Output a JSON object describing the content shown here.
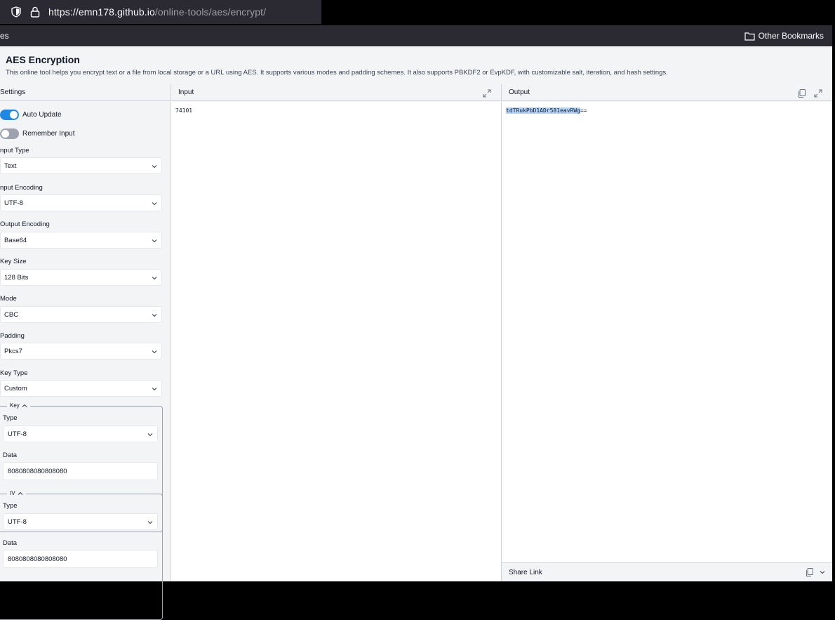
{
  "browser": {
    "url_host": "https://emn178.github.io",
    "url_path": "/online-tools/aes/encrypt/",
    "bookmark_fragment": "es",
    "other_bookmarks": "Other Bookmarks"
  },
  "page": {
    "title": "AES Encryption",
    "description": "This online tool helps you encrypt text or a file from local storage or a URL using AES. It supports various modes and padding schemes. It also supports PBKDF2 or EvpKDF, with customizable salt, iteration, and hash settings."
  },
  "panels": {
    "settings": "Settings",
    "input": "Input",
    "output": "Output",
    "share": "Share Link"
  },
  "settings": {
    "auto_update": "Auto Update",
    "remember_input": "Remember Input",
    "input_type_label": "nput Type",
    "input_type_value": "Text",
    "input_encoding_label": "nput Encoding",
    "input_encoding_value": "UTF-8",
    "output_encoding_label": "Output Encoding",
    "output_encoding_value": "Base64",
    "key_size_label": "Key Size",
    "key_size_value": "128 Bits",
    "mode_label": "Mode",
    "mode_value": "CBC",
    "padding_label": "Padding",
    "padding_value": "Pkcs7",
    "key_type_label": "Key Type",
    "key_type_value": "Custom",
    "key": {
      "legend": "Key",
      "type_label": "Type",
      "type_value": "UTF-8",
      "data_label": "Data",
      "data_value": "8080808080808080"
    },
    "iv": {
      "legend": "IV",
      "type_label": "Type",
      "type_value": "UTF-8",
      "data_label": "Data",
      "data_value": "8080808080808080"
    }
  },
  "input": {
    "text": "74101"
  },
  "output": {
    "selected": "tdTRukPbD1ADr581eavRWg",
    "rest": "=="
  },
  "colors": {
    "accent": "#1e88e5",
    "selection": "#b4d5fe"
  }
}
